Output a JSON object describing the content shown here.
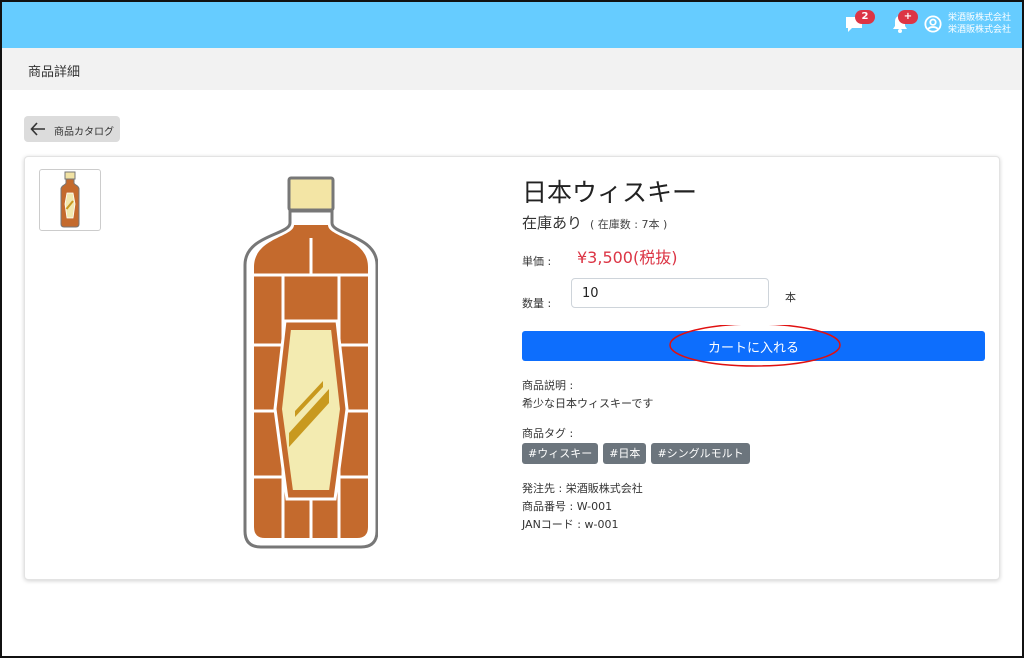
{
  "header": {
    "chat_badge": "2",
    "bell_badge": "+",
    "company_line1": "栄酒販株式会社",
    "company_line2": "栄酒販株式会社",
    "colors": {
      "bar": "#66ccff",
      "badge": "#dc3545"
    },
    "icons": [
      "chat-icon",
      "bell-icon",
      "user-circle-icon"
    ]
  },
  "page": {
    "title": "商品詳細"
  },
  "back": {
    "label": "商品カタログ",
    "icon": "arrow-left-icon"
  },
  "product": {
    "name": "日本ウィスキー",
    "stock_status": "在庫あり",
    "stock_count": "( 在庫数 : 7本 )",
    "price_label": "単価 :",
    "price": "¥3,500(税抜)",
    "qty_label": "数量 :",
    "qty_value": "10",
    "qty_unit": "本",
    "add_to_cart": "カートに入れる",
    "desc_label": "商品説明 :",
    "description": "希少な日本ウィスキーです",
    "tags_label": "商品タグ :",
    "tags": [
      "#ウィスキー",
      "#日本",
      "#シングルモルト"
    ],
    "supplier": "発注先 : 栄酒販株式会社",
    "product_no": "商品番号 : W-001",
    "jan_code": "JANコード : w-001"
  },
  "colors": {
    "price": "#dc3545",
    "button": "#0d6efd",
    "tag": "#6c757d",
    "annotation": "#e01010"
  }
}
